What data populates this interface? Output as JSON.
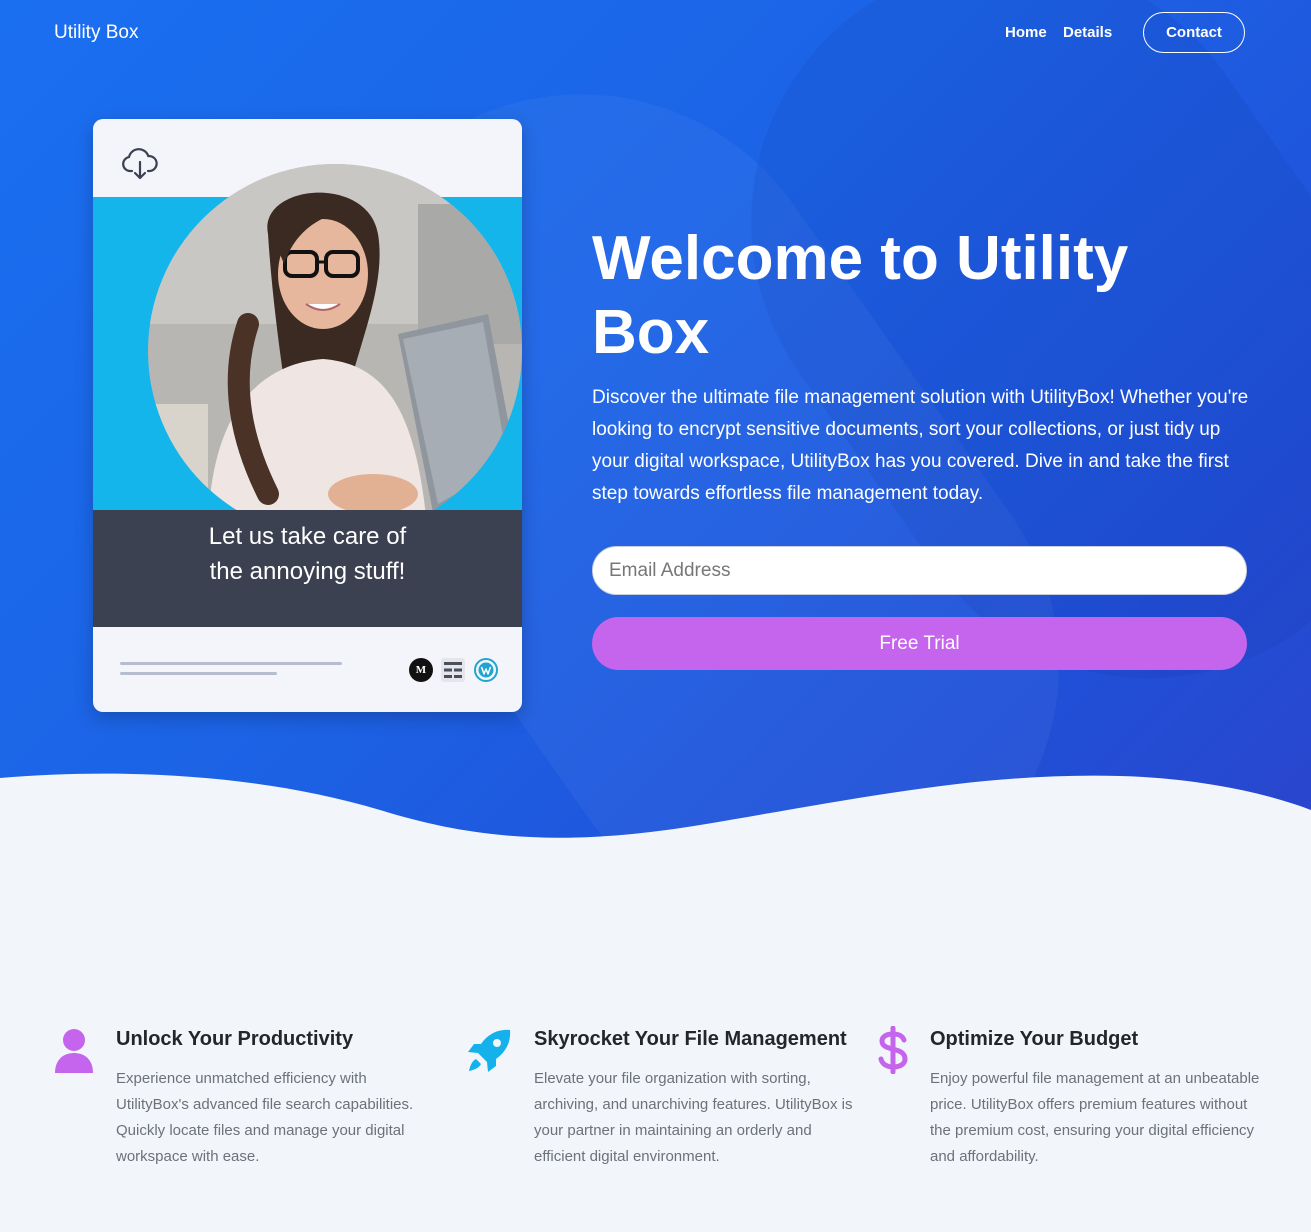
{
  "header": {
    "brand": "Utility Box",
    "nav": [
      {
        "label": "Home"
      },
      {
        "label": "Details"
      }
    ],
    "contact_label": "Contact"
  },
  "hero": {
    "card": {
      "caption_line1": "Let us take care of",
      "caption_line2": "the annoying stuff!",
      "icons": [
        "cloud-download-icon",
        "medium-icon",
        "menu-lines-icon",
        "wordpress-icon"
      ],
      "medium_glyph": "M"
    },
    "title": "Welcome to Utility Box",
    "description": "Discover the ultimate file management solution with UtilityBox! Whether you're looking to encrypt sensitive documents, sort your collections, or just tidy up your digital workspace, UtilityBox has you covered. Dive in and take the first step towards effortless file management today.",
    "email_placeholder": "Email Address",
    "cta_label": "Free Trial"
  },
  "features": [
    {
      "icon": "user-icon",
      "icon_color": "#c564ec",
      "title": "Unlock Your Productivity",
      "text": "Experience unmatched efficiency with UtilityBox's advanced file search capabilities. Quickly locate files and manage your digital workspace with ease."
    },
    {
      "icon": "rocket-icon",
      "icon_color": "#14b1ea",
      "title": "Skyrocket Your File Management",
      "text": "Elevate your file organization with sorting, archiving, and unarchiving features. UtilityBox is your partner in maintaining an orderly and efficient digital environment."
    },
    {
      "icon": "dollar-icon",
      "icon_color": "#c564ec",
      "title": "Optimize Your Budget",
      "text": "Enjoy powerful file management at an unbeatable price. UtilityBox offers premium features without the premium cost, ensuring your digital efficiency and affordability."
    }
  ],
  "colors": {
    "hero_gradient_start": "#1a6ff0",
    "hero_gradient_end": "#2a45cc",
    "cta": "#c564ec",
    "card_band": "#13b5ea",
    "card_dark": "#3c4152",
    "page_bg": "#f2f6fa"
  }
}
